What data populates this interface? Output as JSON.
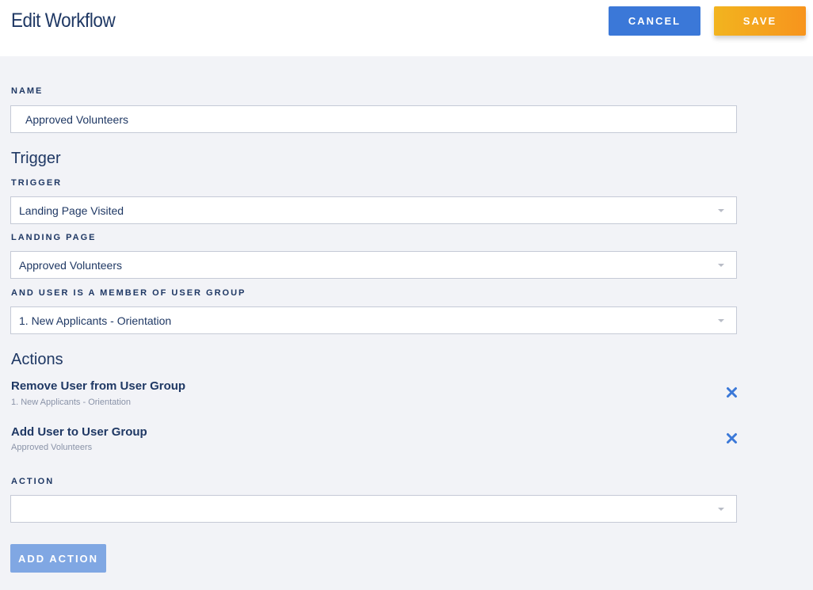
{
  "header": {
    "title": "Edit Workflow",
    "cancel_label": "CANCEL",
    "save_label": "SAVE"
  },
  "name_field": {
    "label": "NAME",
    "value": "Approved Volunteers"
  },
  "trigger_section": {
    "title": "Trigger",
    "trigger": {
      "label": "TRIGGER",
      "value": "Landing Page Visited"
    },
    "landing_page": {
      "label": "LANDING PAGE",
      "value": "Approved Volunteers"
    },
    "user_group": {
      "label": "AND USER IS A MEMBER OF USER GROUP",
      "value": "1. New Applicants - Orientation"
    }
  },
  "actions_section": {
    "title": "Actions",
    "items": [
      {
        "title": "Remove User from User Group",
        "subtitle": "1. New Applicants - Orientation"
      },
      {
        "title": "Add User to User Group",
        "subtitle": "Approved Volunteers"
      }
    ],
    "action_select": {
      "label": "ACTION",
      "value": ""
    },
    "add_label": "ADD ACTION"
  },
  "colors": {
    "primary": "#3b78d8",
    "save_gradient_start": "#f2b41f",
    "save_gradient_end": "#f7941d",
    "text": "#1f3864",
    "background": "#f2f3f7"
  },
  "icons": {
    "remove": "close-icon",
    "dropdown": "chevron-down-icon"
  }
}
